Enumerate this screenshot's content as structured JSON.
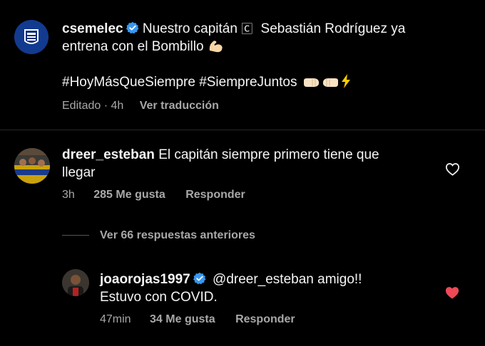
{
  "post": {
    "username": "csemelec",
    "caption_line1": "Nuestro capitán",
    "caption_glyph": "🄲",
    "caption_line1b": "Sebastián Rodríguez ya",
    "caption_line2": "entrena con el Bombillo",
    "hashtags": "#HoyMásQueSiempre #SiempreJuntos",
    "meta_edited": "Editado · 4h",
    "translate_label": "Ver traducción"
  },
  "comment1": {
    "username": "dreer_esteban",
    "text_line1": "El capitán siempre primero tiene que",
    "text_line2": "llegar",
    "time": "3h",
    "likes": "285 Me gusta",
    "reply_label": "Responder"
  },
  "view_replies": "Ver 66 respuestas anteriores",
  "reply1": {
    "username": "joaorojas1997",
    "text_line1": "@dreer_esteban amigo!!",
    "text_line2": "Estuvo con COVID.",
    "time": "47min",
    "likes": "34 Me gusta",
    "reply_label": "Responder"
  },
  "colors": {
    "background": "#000000",
    "verified": "#3897f0",
    "heart_liked": "#ed4956",
    "meta_text": "#a8a8a8"
  }
}
